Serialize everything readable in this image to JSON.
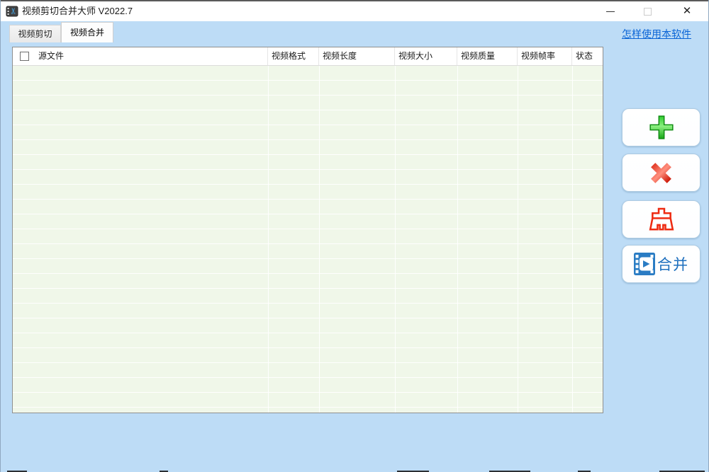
{
  "window": {
    "title": "视频剪切合并大师 V2022.7",
    "close_glyph": "✕"
  },
  "tabs": [
    {
      "label": "视频剪切",
      "active": false
    },
    {
      "label": "视频合并",
      "active": true
    }
  ],
  "help_link": {
    "label": "怎样使用本软件"
  },
  "table": {
    "columns": [
      "源文件",
      "视频格式",
      "视频长度",
      "视频大小",
      "视频质量",
      "视频帧率",
      "状态"
    ],
    "rows": [],
    "select_all_checked": false
  },
  "action_buttons": [
    {
      "id": "add",
      "icon": "plus-icon",
      "label": ""
    },
    {
      "id": "remove",
      "icon": "x-icon",
      "label": ""
    },
    {
      "id": "clear",
      "icon": "broom-icon",
      "label": ""
    },
    {
      "id": "merge",
      "icon": "filmstrip-play-icon",
      "label": "合并"
    }
  ],
  "colors": {
    "client_bg": "#bddcf6",
    "titlebar_bg": "#ffffff",
    "table_body_bg": "#f0f7e9",
    "link_blue": "#0a64d6",
    "add_green": "#1fb321",
    "remove_red": "#e0251a",
    "clear_red": "#ee2b12",
    "merge_blue": "#2a7cc4"
  }
}
